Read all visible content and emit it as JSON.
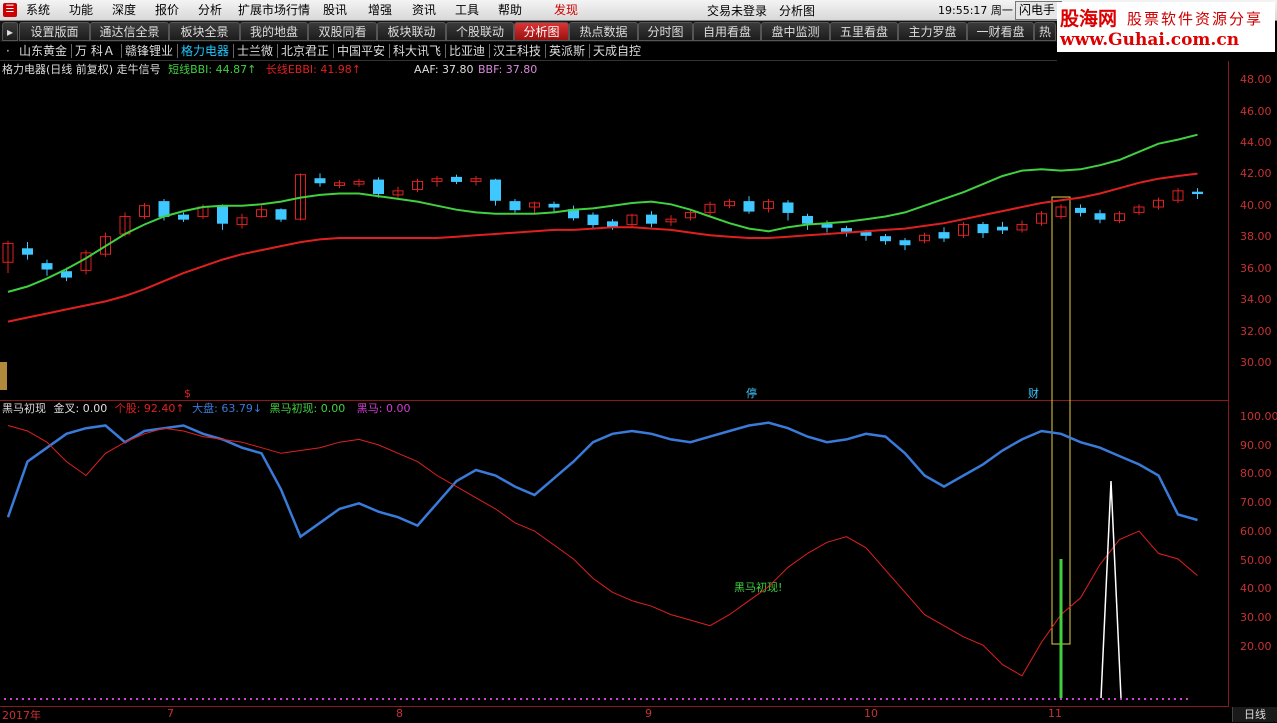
{
  "menu": {
    "items": [
      "系统",
      "功能",
      "深度",
      "报价",
      "分析",
      "扩展市场行情",
      "股讯",
      "增强",
      "资讯",
      "工具",
      "帮助",
      "发现"
    ],
    "highlight_index": 11,
    "status_login": "交易未登录",
    "status_view": "分析图",
    "clock": "19:55:17 周一",
    "flash_button": "闪电手"
  },
  "logo": {
    "name": "股海网",
    "slogan": "股票软件资源分享",
    "url": "www.Guhai.com.cn"
  },
  "tabs": [
    "设置版面",
    "通达信全景",
    "板块全景",
    "我的地盘",
    "双股同看",
    "板块联动",
    "个股联动",
    "分析图",
    "热点数据",
    "分时图",
    "自用看盘",
    "盘中监测",
    "五里看盘",
    "主力罗盘",
    "一财看盘",
    "热"
  ],
  "active_tab": 7,
  "stocks": [
    "·",
    "山东黄金",
    "万 科Ａ",
    "赣锋锂业",
    "格力电器",
    "士兰微",
    "北京君正",
    "中国平安",
    "科大讯飞",
    "比亚迪",
    "汉王科技",
    "英派斯",
    "天成自控"
  ],
  "active_stock": 4,
  "main_info": {
    "title": "格力电器(日线 前复权) 走牛信号",
    "short_label": "短线BBI: 44.87↑",
    "long_label": "长线EBBI: 41.98↑",
    "aaf": "AAF: 37.80",
    "bbf": "BBF: 37.80"
  },
  "sub_info": {
    "name": "黑马初现",
    "jincha": "金叉: 0.00",
    "gegu": "个股: 92.40↑",
    "dapan": "大盘: 63.79↓",
    "heima_chuxian": "黑马初现: 0.00",
    "heima": "黑马: 0.00"
  },
  "markers": {
    "dollar": "$",
    "ting": "停",
    "cai": "财",
    "heima_label": "黑马初现!"
  },
  "price_axis": [
    "48.00",
    "46.00",
    "44.00",
    "42.00",
    "40.00",
    "38.00",
    "36.00",
    "34.00",
    "32.00",
    "30.00"
  ],
  "sub_axis": [
    "100.00",
    "90.00",
    "80.00",
    "70.00",
    "60.00",
    "50.00",
    "40.00",
    "30.00",
    "20.00"
  ],
  "time_axis": [
    "2017年",
    "7",
    "8",
    "9",
    "10",
    "11"
  ],
  "period_button": "日线",
  "colors": {
    "up": "#e02020",
    "down": "#3ec8ff",
    "bbi": "#40d040",
    "ebbi": "#e02020",
    "dapan": "#3a7ad8",
    "gegu": "#e02020",
    "grid": "#8a1a1a"
  },
  "chart_data": {
    "type": "line",
    "price_panel": {
      "ylim": [
        28.0,
        49.0
      ],
      "bbi": [
        33.2,
        33.6,
        34.2,
        34.9,
        35.7,
        36.6,
        37.5,
        38.2,
        38.8,
        39.2,
        39.5,
        39.6,
        39.6,
        39.7,
        39.9,
        40.2,
        40.4,
        40.5,
        40.5,
        40.3,
        40.1,
        39.9,
        39.6,
        39.3,
        39.1,
        39.0,
        39.0,
        39.0,
        39.1,
        39.3,
        39.4,
        39.6,
        39.8,
        39.9,
        39.7,
        39.3,
        38.8,
        38.3,
        37.9,
        37.7,
        38.0,
        38.2,
        38.3,
        38.4,
        38.6,
        38.8,
        39.1,
        39.6,
        40.1,
        40.6,
        41.2,
        41.8,
        42.2,
        42.3,
        42.2,
        42.3,
        42.6,
        43.0,
        43.6,
        44.2,
        44.5,
        44.87
      ],
      "ebbi": [
        31.0,
        31.3,
        31.6,
        31.9,
        32.2,
        32.5,
        32.9,
        33.4,
        34.0,
        34.6,
        35.1,
        35.6,
        36.0,
        36.3,
        36.6,
        36.9,
        37.1,
        37.2,
        37.2,
        37.2,
        37.2,
        37.2,
        37.2,
        37.3,
        37.4,
        37.5,
        37.6,
        37.7,
        37.8,
        37.8,
        37.9,
        38.0,
        38.0,
        37.9,
        37.8,
        37.6,
        37.4,
        37.3,
        37.2,
        37.2,
        37.3,
        37.4,
        37.5,
        37.6,
        37.7,
        37.8,
        37.9,
        38.1,
        38.3,
        38.6,
        38.9,
        39.2,
        39.5,
        39.8,
        40.0,
        40.2,
        40.5,
        40.9,
        41.3,
        41.6,
        41.8,
        41.98
      ],
      "candles": [
        [
          35.4,
          36.8,
          34.6,
          37.0
        ],
        [
          36.4,
          36.0,
          35.6,
          36.9
        ],
        [
          35.3,
          34.9,
          34.4,
          35.6
        ],
        [
          34.7,
          34.3,
          34.0,
          35.0
        ],
        [
          34.8,
          36.1,
          34.5,
          36.3
        ],
        [
          36.0,
          37.3,
          35.8,
          37.6
        ],
        [
          37.5,
          38.8,
          37.3,
          39.1
        ],
        [
          38.8,
          39.6,
          38.6,
          39.8
        ],
        [
          39.9,
          38.8,
          38.5,
          40.1
        ],
        [
          38.9,
          38.6,
          38.4,
          39.1
        ],
        [
          38.8,
          39.5,
          38.6,
          39.7
        ],
        [
          39.5,
          38.3,
          37.8,
          39.7
        ],
        [
          38.2,
          38.7,
          37.9,
          39.0
        ],
        [
          38.8,
          39.3,
          38.7,
          39.6
        ],
        [
          39.3,
          38.6,
          38.4,
          39.4
        ],
        [
          38.6,
          41.9,
          38.5,
          42.0
        ],
        [
          41.6,
          41.3,
          41.0,
          42.0
        ],
        [
          41.1,
          41.3,
          40.9,
          41.5
        ],
        [
          41.2,
          41.4,
          41.0,
          41.6
        ],
        [
          41.5,
          40.5,
          40.2,
          41.7
        ],
        [
          40.4,
          40.7,
          40.2,
          41.0
        ],
        [
          40.8,
          41.4,
          40.6,
          41.6
        ],
        [
          41.4,
          41.6,
          41.0,
          41.8
        ],
        [
          41.7,
          41.4,
          41.2,
          41.9
        ],
        [
          41.4,
          41.6,
          41.1,
          41.8
        ],
        [
          41.5,
          40.0,
          39.6,
          41.6
        ],
        [
          39.9,
          39.3,
          39.0,
          40.1
        ],
        [
          39.5,
          39.8,
          39.0,
          39.9
        ],
        [
          39.7,
          39.5,
          39.1,
          39.9
        ],
        [
          39.3,
          38.7,
          38.5,
          39.6
        ],
        [
          38.9,
          38.2,
          37.9,
          39.1
        ],
        [
          38.4,
          38.0,
          37.8,
          38.6
        ],
        [
          38.2,
          38.9,
          38.0,
          39.0
        ],
        [
          38.9,
          38.3,
          38.0,
          39.2
        ],
        [
          38.4,
          38.6,
          38.1,
          38.9
        ],
        [
          38.7,
          39.1,
          38.5,
          39.3
        ],
        [
          39.1,
          39.7,
          38.9,
          39.9
        ],
        [
          39.6,
          39.9,
          39.4,
          40.1
        ],
        [
          39.9,
          39.2,
          39.0,
          40.3
        ],
        [
          39.4,
          39.9,
          39.1,
          40.1
        ],
        [
          39.8,
          39.1,
          38.5,
          40.0
        ],
        [
          38.8,
          38.3,
          37.8,
          39.0
        ],
        [
          38.2,
          38.0,
          37.6,
          38.5
        ],
        [
          37.9,
          37.7,
          37.3,
          38.1
        ],
        [
          37.6,
          37.4,
          37.0,
          37.8
        ],
        [
          37.3,
          37.0,
          36.7,
          37.5
        ],
        [
          37.0,
          36.7,
          36.3,
          37.2
        ],
        [
          37.0,
          37.4,
          36.8,
          37.6
        ],
        [
          37.6,
          37.2,
          36.9,
          38.0
        ],
        [
          37.4,
          38.2,
          37.2,
          38.4
        ],
        [
          38.2,
          37.6,
          37.2,
          38.4
        ],
        [
          38.0,
          37.8,
          37.5,
          38.4
        ],
        [
          37.8,
          38.2,
          37.6,
          38.5
        ],
        [
          38.3,
          39.0,
          38.1,
          39.2
        ],
        [
          38.8,
          39.5,
          38.6,
          39.7
        ],
        [
          39.4,
          39.1,
          38.8,
          39.7
        ],
        [
          39.0,
          38.6,
          38.3,
          39.3
        ],
        [
          38.5,
          39.0,
          38.3,
          39.2
        ],
        [
          39.1,
          39.5,
          38.9,
          39.7
        ],
        [
          39.5,
          40.0,
          39.3,
          40.2
        ],
        [
          40.0,
          40.7,
          39.8,
          40.9
        ],
        [
          40.6,
          40.5,
          40.1,
          40.9
        ]
      ]
    },
    "sub_panel": {
      "ylim": [
        0,
        105
      ],
      "gegu": [
        98,
        96,
        92,
        85,
        80,
        88,
        92,
        95,
        97,
        96,
        94,
        93,
        92,
        90,
        88,
        89,
        90,
        92,
        93,
        91,
        88,
        85,
        80,
        76,
        72,
        68,
        63,
        60,
        55,
        50,
        43,
        38,
        35,
        33,
        30,
        28,
        26,
        30,
        35,
        40,
        47,
        52,
        56,
        58,
        54,
        46,
        38,
        30,
        26,
        22,
        19,
        12,
        8,
        20,
        30,
        36,
        48,
        57,
        60,
        52,
        50,
        44
      ],
      "dapan": [
        65,
        85,
        90,
        95,
        97,
        98,
        92,
        96,
        97,
        98,
        95,
        93,
        90,
        88,
        75,
        58,
        63,
        68,
        70,
        67,
        65,
        62,
        70,
        78,
        82,
        80,
        76,
        73,
        79,
        85,
        92,
        95,
        96,
        95,
        93,
        92,
        94,
        96,
        98,
        99,
        97,
        94,
        92,
        93,
        95,
        94,
        88,
        80,
        76,
        80,
        84,
        89,
        93,
        96,
        95,
        92,
        90,
        87,
        84,
        80,
        66,
        64
      ],
      "heima_spike_index": 54
    }
  }
}
